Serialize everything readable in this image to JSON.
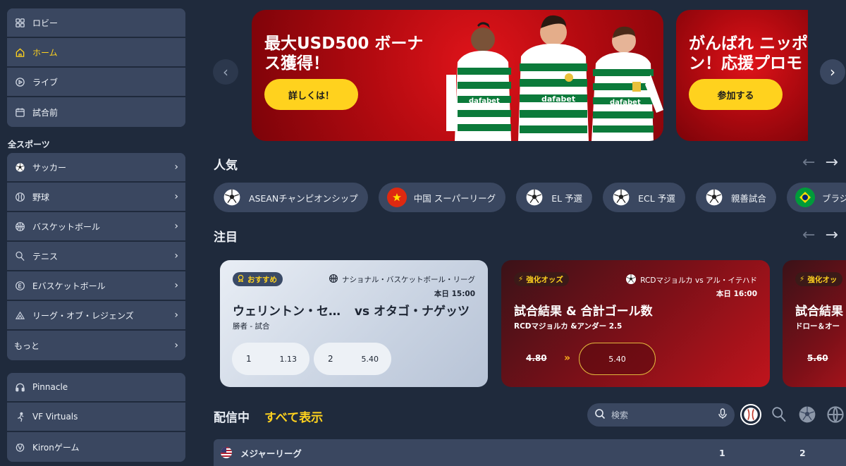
{
  "sidebar": {
    "top_items": [
      {
        "label": "ロビー",
        "icon": "grid-icon"
      },
      {
        "label": "ホーム",
        "icon": "home-icon",
        "active": true
      },
      {
        "label": "ライブ",
        "icon": "play-circle-icon"
      },
      {
        "label": "試合前",
        "icon": "calendar-icon"
      }
    ],
    "sports_label": "全スポーツ",
    "sports": [
      {
        "label": "サッカー",
        "icon": "soccer-ball-icon"
      },
      {
        "label": "野球",
        "icon": "baseball-icon"
      },
      {
        "label": "バスケットボール",
        "icon": "basketball-icon"
      },
      {
        "label": "テニス",
        "icon": "tennis-racket-icon"
      },
      {
        "label": "Eバスケットボール",
        "icon": "ebasketball-icon"
      },
      {
        "label": "リーグ・オブ・レジェンズ",
        "icon": "league-of-legends-icon"
      },
      {
        "label": "もっと",
        "icon": ""
      }
    ],
    "providers": [
      {
        "label": "Pinnacle",
        "icon": "headset-icon"
      },
      {
        "label": "VF Virtuals",
        "icon": "vf-virtuals-icon"
      },
      {
        "label": "Kironゲーム",
        "icon": "kiron-icon"
      }
    ]
  },
  "banners": [
    {
      "title_line1": "最大USD500 ボーナ",
      "title_line2": "ス獲得！",
      "button": "詳しくは！",
      "jersey_text": "dafabet"
    },
    {
      "title_line1": "がんばれ ニッポ",
      "title_line2": "ン！応援プロモ",
      "button": "参加する"
    }
  ],
  "popular": {
    "title": "人気",
    "chips": [
      {
        "label": "ASEANチャンピオンシップ",
        "icon": "soccer-ball-icon"
      },
      {
        "label": "中国 スーパーリーグ",
        "icon": "china-flag-icon"
      },
      {
        "label": "EL 予選",
        "icon": "soccer-ball-icon"
      },
      {
        "label": "ECL 予選",
        "icon": "soccer-ball-icon"
      },
      {
        "label": "親善試合",
        "icon": "soccer-ball-icon"
      },
      {
        "label": "ブラジ",
        "icon": "brazil-flag-icon"
      }
    ]
  },
  "featured": {
    "title": "注目",
    "card1": {
      "badge": "おすすめ",
      "league": "ナショナル・バスケットボール・リーグ",
      "time": "本日 15:00",
      "match_left": "ウェリントン・セ…",
      "match_right": "vs オタゴ・ナゲッツ",
      "market": "勝者 - 試合",
      "odds": [
        {
          "label": "1",
          "value": "1.13"
        },
        {
          "label": "2",
          "value": "5.40"
        }
      ]
    },
    "card2": {
      "badge": "強化オッズ",
      "league": "RCDマジョルカ vs アル・イテハド",
      "time": "本日 16:00",
      "title": "試合結果 & 合計ゴール数",
      "subtitle": "RCDマジョルカ &アンダー 2.5",
      "old_odds": "4.80",
      "new_odds": "5.40"
    },
    "card3": {
      "badge": "強化オッ",
      "title": "試合結果",
      "subtitle": "ドロー＆オー",
      "old_odds": "5.60"
    }
  },
  "live": {
    "title": "配信中",
    "show_all": "すべて表示",
    "search_placeholder": "検索",
    "league_row": {
      "name": "メジャーリーグ",
      "col1": "1",
      "col2": "2"
    }
  },
  "colors": {
    "accent": "#ffd21e",
    "panel": "#3a4760",
    "background": "#1f2a3c",
    "banner_red": "#c8101a"
  }
}
